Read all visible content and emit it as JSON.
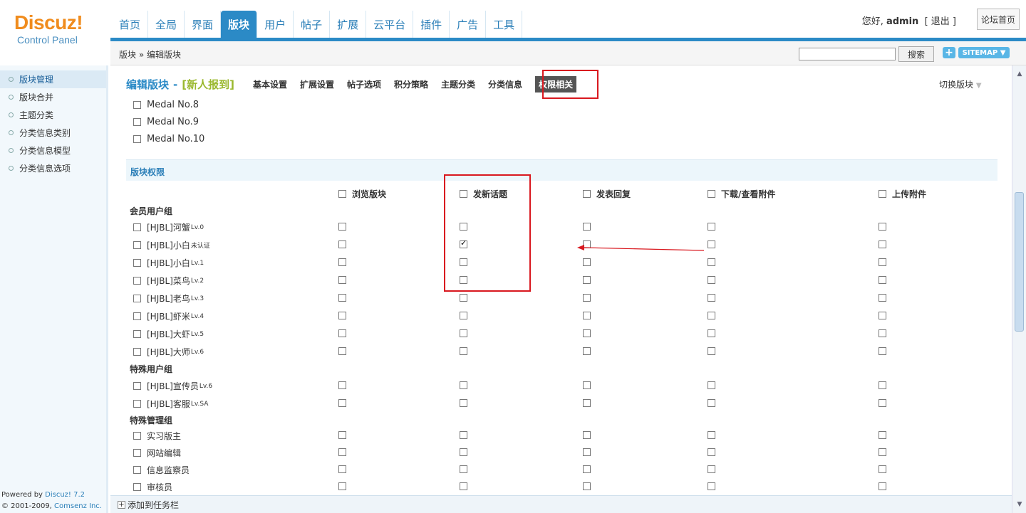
{
  "header": {
    "brand": "Discuz!",
    "sub": "Control Panel",
    "nav": [
      "首页",
      "全局",
      "界面",
      "版块",
      "用户",
      "帖子",
      "扩展",
      "云平台",
      "插件",
      "广告",
      "工具"
    ],
    "greeting": "您好,",
    "user": "admin",
    "logout": "[ 退出 ]",
    "forum_home": "论坛首页"
  },
  "breadcrumb": "版块 » 编辑版块",
  "search": {
    "button": "搜索",
    "value": ""
  },
  "sitemap": "SITEMAP",
  "plus": "+",
  "sidebar": {
    "items": [
      "版块管理",
      "版块合并",
      "主题分类",
      "分类信息类别",
      "分类信息模型",
      "分类信息选项"
    ],
    "powered_prefix": "Powered by ",
    "powered_link": "Discuz! 7.2",
    "copyright_prefix": "© 2001-2009, ",
    "copyright_link": "Comsenz Inc."
  },
  "page": {
    "title": "编辑版块",
    "separator": "-",
    "forum_name": "[新人报到]",
    "subtabs": [
      "基本设置",
      "扩展设置",
      "帖子选项",
      "积分策略",
      "主题分类",
      "分类信息",
      "权限相关"
    ],
    "switch_forum": "切换版块"
  },
  "medals": [
    "Medal No.8",
    "Medal No.9",
    "Medal No.10"
  ],
  "perm_section": "版块权限",
  "columns": [
    "浏览版块",
    "发新话题",
    "发表回复",
    "下载/查看附件",
    "上传附件"
  ],
  "groups": [
    {
      "title": "会员用户组",
      "rows": [
        {
          "name": "[HJBL]河蟹",
          "sup": "Lv.0"
        },
        {
          "name": "[HJBL]小白",
          "sup": "未认证"
        },
        {
          "name": "[HJBL]小白",
          "sup": "Lv.1"
        },
        {
          "name": "[HJBL]菜鸟",
          "sup": "Lv.2"
        },
        {
          "name": "[HJBL]老鸟",
          "sup": "Lv.3"
        },
        {
          "name": "[HJBL]虾米",
          "sup": "Lv.4"
        },
        {
          "name": "[HJBL]大虾",
          "sup": "Lv.5"
        },
        {
          "name": "[HJBL]大师",
          "sup": "Lv.6"
        }
      ]
    },
    {
      "title": "特殊用户组",
      "rows": [
        {
          "name": "[HJBL]宣传员",
          "sup": "Lv.6"
        },
        {
          "name": "[HJBL]客服",
          "sup": "Lv.SA"
        }
      ]
    },
    {
      "title": "特殊管理组",
      "rows": [
        {
          "name": "实习版主",
          "sup": ""
        },
        {
          "name": "网站编辑",
          "sup": ""
        },
        {
          "name": "信息监察员",
          "sup": ""
        },
        {
          "name": "审核员",
          "sup": ""
        }
      ]
    }
  ],
  "bottom": {
    "add_task": "添加到任务栏"
  },
  "colors": {
    "accent": "#2b8ac6",
    "logo": "#f08c1e",
    "annotation": "#d9181f"
  }
}
